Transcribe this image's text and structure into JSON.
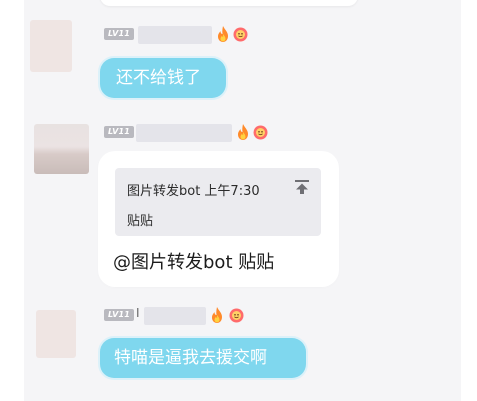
{
  "colors": {
    "background": "#f5f5f7",
    "bubble_blue": "#7fd7ee",
    "level_badge": "#b9b9bf",
    "quote_background": "#ebebef"
  },
  "messages": [
    {
      "level": "LV11",
      "text": "还不给钱了",
      "icons": [
        "flame-icon",
        "smiley-badge-icon"
      ]
    },
    {
      "level": "LV11",
      "quote": {
        "title": "图片转发bot 上午7:30",
        "body": "贴贴",
        "icon": "jump-to-message-icon"
      },
      "text": "@图片转发bot 贴贴",
      "icons": [
        "flame-icon",
        "smiley-badge-icon"
      ]
    },
    {
      "level": "LV11",
      "name_fragment": "I",
      "text": "特喵是逼我去援交啊",
      "icons": [
        "flame-icon",
        "smiley-badge-icon"
      ]
    }
  ]
}
